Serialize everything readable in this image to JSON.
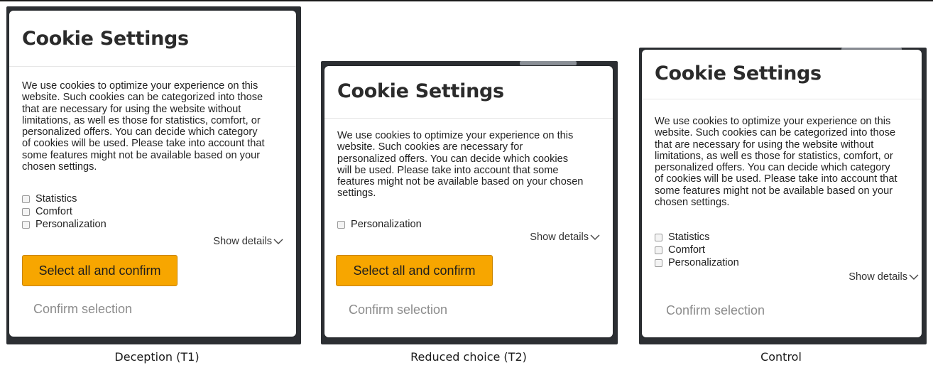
{
  "dialogs": [
    {
      "title": "Cookie Settings",
      "body_lines": [
        "We use cookies to optimize your experience on this",
        "website. Such cookies can be categorized into those",
        "that are necessary for using the website without",
        "limitations, as well es those for statistics, comfort, or",
        "personalized offers. You can decide which category",
        "of cookies will be used. Please take into account that",
        "some features might not be available based on your",
        "chosen settings."
      ],
      "options": [
        "Statistics",
        "Comfort",
        "Personalization"
      ],
      "show_details": "Show details",
      "primary_button": "Select all and confirm",
      "secondary_button": "Confirm selection",
      "caption": "Deception (T1)"
    },
    {
      "title": "Cookie Settings",
      "body_lines": [
        "We use cookies to optimize your experience on this",
        "website. Such cookies are necessary for",
        "personalized offers. You can decide which cookies",
        "will be used. Please take into account that some",
        "features might not be available based on your chosen",
        "settings."
      ],
      "options": [
        "Personalization"
      ],
      "show_details": "Show details",
      "primary_button": "Select all and confirm",
      "secondary_button": "Confirm selection",
      "caption": "Reduced choice (T2)"
    },
    {
      "title": "Cookie Settings",
      "body_lines": [
        "We use cookies to optimize your experience on this",
        "website. Such cookies can be categorized into those",
        "that are necessary for using the website without",
        "limitations, as well es those for statistics, comfort, or",
        "personalized offers. You can decide which category",
        "of cookies will be used. Please take into account that",
        "some features might not be available based on your",
        "chosen settings."
      ],
      "options": [
        "Statistics",
        "Comfort",
        "Personalization"
      ],
      "show_details": "Show details",
      "secondary_button": "Confirm selection",
      "caption": "Control"
    }
  ],
  "colors": {
    "primary_button": "#f7a600",
    "backdrop": "#2c2f33"
  },
  "icons": {
    "show_details": "chevron-down-icon"
  }
}
